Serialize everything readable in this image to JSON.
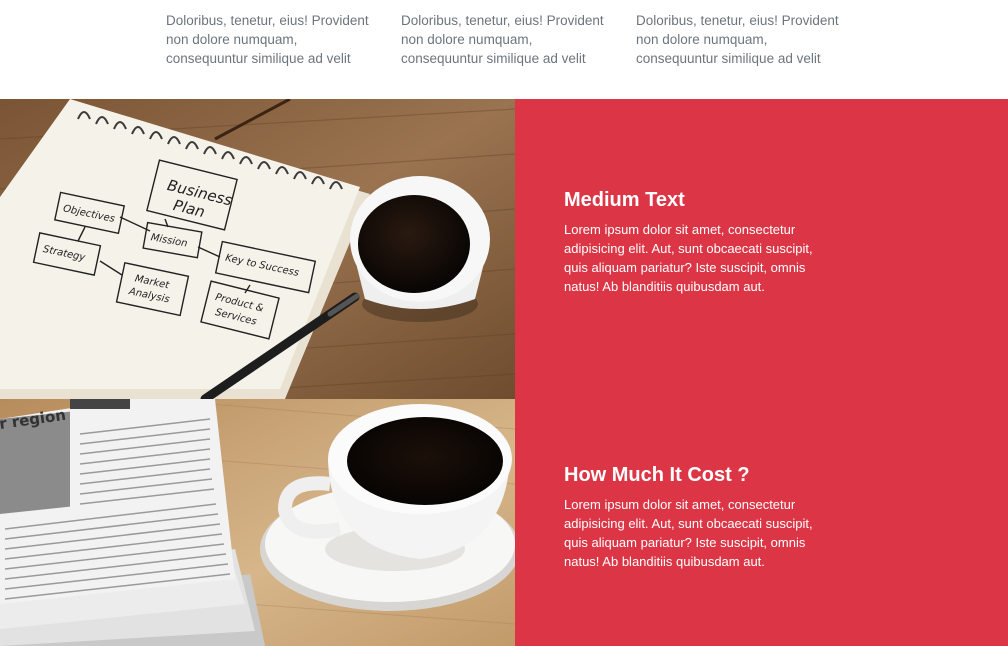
{
  "features": [
    {
      "text": "Doloribus, tenetur, eius! Provident non dolore numquam, consequuntur similique ad velit"
    },
    {
      "text": "Doloribus, tenetur, eius! Provident non dolore numquam, consequuntur similique ad velit"
    },
    {
      "text": "Doloribus, tenetur, eius! Provident non dolore numquam, consequuntur similique ad velit"
    }
  ],
  "images": {
    "notebook": {
      "title_line1": "Business",
      "title_line2": "Plan",
      "boxes": {
        "objectives": "Objectives",
        "mission": "Mission",
        "strategy": "Strategy",
        "key_to_success": "Key to Success",
        "market_line1": "Market",
        "market_line2": "Analysis",
        "product_line1": "Product &",
        "product_line2": "Services"
      }
    },
    "newspaper": {
      "headline": "r region"
    }
  },
  "blocks": [
    {
      "title": "Medium Text",
      "body": "Lorem ipsum dolor sit amet, consectetur adipisicing elit. Aut, sunt obcaecati suscipit, quis aliquam pariatur? Iste suscipit, omnis natus! Ab blanditiis quibusdam aut."
    },
    {
      "title": "How Much It Cost ?",
      "body": "Lorem ipsum dolor sit amet, consectetur adipisicing elit. Aut, sunt obcaecati suscipit, quis aliquam pariatur? Iste suscipit, omnis natus! Ab blanditiis quibusdam aut."
    }
  ],
  "colors": {
    "accent": "#dc3545",
    "muted_text": "#6c757d"
  }
}
